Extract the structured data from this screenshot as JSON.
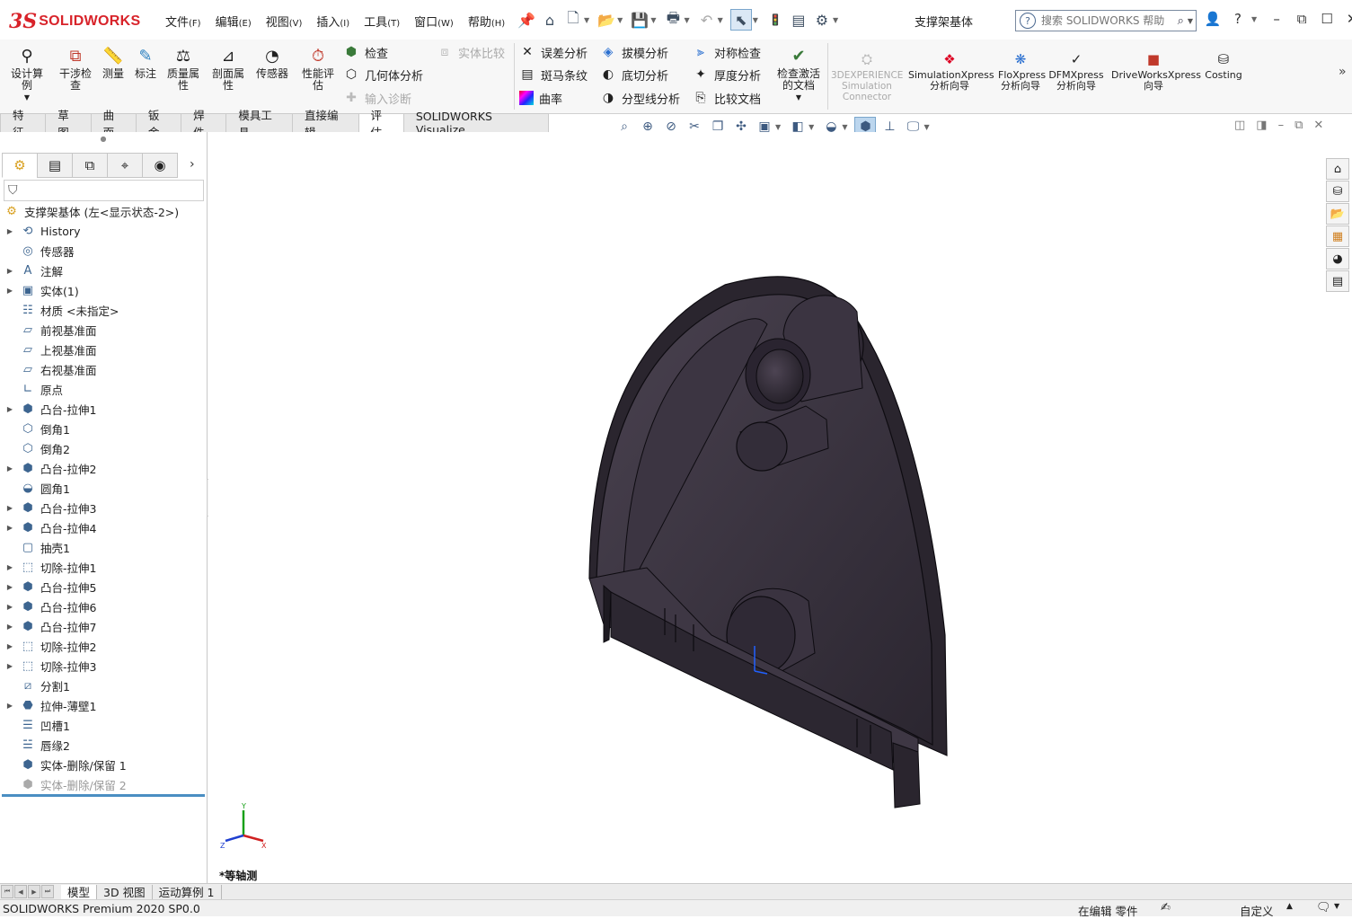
{
  "app": {
    "logo_prefix": "3S",
    "logo_name": "SOLIDWORKS",
    "document_title": "支撑架基体",
    "status_text": "SOLIDWORKS Premium 2020 SP0.0"
  },
  "menu": [
    {
      "label": "文件",
      "key": "(F)"
    },
    {
      "label": "编辑",
      "key": "(E)"
    },
    {
      "label": "视图",
      "key": "(V)"
    },
    {
      "label": "插入",
      "key": "(I)"
    },
    {
      "label": "工具",
      "key": "(T)"
    },
    {
      "label": "窗口",
      "key": "(W)"
    },
    {
      "label": "帮助",
      "key": "(H)"
    }
  ],
  "search": {
    "placeholder": "搜索 SOLIDWORKS 帮助"
  },
  "ribbon": {
    "design_study": "设计算例",
    "interference": "干涉检查",
    "measure": "测量",
    "markup": "标注",
    "mass_props": "质量属性",
    "section_props": "剖面属性",
    "sensor": "传感器",
    "performance": "性能评估",
    "check": "检查",
    "geometry_analysis": "几何体分析",
    "import_diag": "输入诊断",
    "body_compare": "实体比较",
    "deviation": "误差分析",
    "zebra": "斑马条纹",
    "curvature": "曲率",
    "draft": "拔模分析",
    "undercut": "底切分析",
    "parting_line": "分型线分析",
    "symmetry": "对称检查",
    "thickness": "厚度分析",
    "compare_docs": "比较文档",
    "check_active": "检查激活的文档",
    "dx_connector": "3DEXPERIENCE Simulation Connector",
    "simxpress": "SimulationXpress 分析向导",
    "floxpress": "FloXpress 分析向导",
    "dfmxpress": "DFMXpress 分析向导",
    "driveworks": "DriveWorksXpress 向导",
    "costing": "Costing"
  },
  "tabs": [
    "特征",
    "草图",
    "曲面",
    "钣金",
    "焊件",
    "模具工具",
    "直接编辑",
    "评估",
    "SOLIDWORKS Visualize"
  ],
  "active_tab": "评估",
  "tree": {
    "root": "支撑架基体  (左<显示状态-2>)",
    "items": [
      {
        "label": "History",
        "expandable": true,
        "icon": "history-icon"
      },
      {
        "label": "传感器",
        "expandable": false,
        "icon": "sensor-icon"
      },
      {
        "label": "注解",
        "expandable": true,
        "icon": "annotation-icon"
      },
      {
        "label": "实体(1)",
        "expandable": true,
        "icon": "solid-bodies-icon"
      },
      {
        "label": "材质 <未指定>",
        "expandable": false,
        "icon": "material-icon"
      },
      {
        "label": "前视基准面",
        "expandable": false,
        "icon": "plane-icon"
      },
      {
        "label": "上视基准面",
        "expandable": false,
        "icon": "plane-icon"
      },
      {
        "label": "右视基准面",
        "expandable": false,
        "icon": "plane-icon"
      },
      {
        "label": "原点",
        "expandable": false,
        "icon": "origin-icon"
      },
      {
        "label": "凸台-拉伸1",
        "expandable": true,
        "icon": "boss-extrude-icon"
      },
      {
        "label": "倒角1",
        "expandable": false,
        "icon": "chamfer-icon"
      },
      {
        "label": "倒角2",
        "expandable": false,
        "icon": "chamfer-icon"
      },
      {
        "label": "凸台-拉伸2",
        "expandable": true,
        "icon": "boss-extrude-icon"
      },
      {
        "label": "圆角1",
        "expandable": false,
        "icon": "fillet-icon"
      },
      {
        "label": "凸台-拉伸3",
        "expandable": true,
        "icon": "boss-extrude-icon"
      },
      {
        "label": "凸台-拉伸4",
        "expandable": true,
        "icon": "boss-extrude-icon"
      },
      {
        "label": "抽壳1",
        "expandable": false,
        "icon": "shell-icon"
      },
      {
        "label": "切除-拉伸1",
        "expandable": true,
        "icon": "cut-extrude-icon"
      },
      {
        "label": "凸台-拉伸5",
        "expandable": true,
        "icon": "boss-extrude-icon"
      },
      {
        "label": "凸台-拉伸6",
        "expandable": true,
        "icon": "boss-extrude-icon"
      },
      {
        "label": "凸台-拉伸7",
        "expandable": true,
        "icon": "boss-extrude-icon"
      },
      {
        "label": "切除-拉伸2",
        "expandable": true,
        "icon": "cut-extrude-icon"
      },
      {
        "label": "切除-拉伸3",
        "expandable": true,
        "icon": "cut-extrude-icon"
      },
      {
        "label": "分割1",
        "expandable": false,
        "icon": "split-icon"
      },
      {
        "label": "拉伸-薄壁1",
        "expandable": true,
        "icon": "thin-extrude-icon"
      },
      {
        "label": "凹槽1",
        "expandable": false,
        "icon": "groove-icon"
      },
      {
        "label": "唇缘2",
        "expandable": false,
        "icon": "lip-icon"
      },
      {
        "label": "实体-删除/保留 1",
        "expandable": false,
        "icon": "delete-body-icon"
      },
      {
        "label": "实体-删除/保留 2",
        "expandable": false,
        "icon": "delete-body-icon",
        "suppressed": true
      }
    ]
  },
  "viewport": {
    "view_label": "*等轴测",
    "triad": {
      "x": "X",
      "y": "Y",
      "z": "Z"
    }
  },
  "bottom_tabs": [
    "模型",
    "3D 视图",
    "运动算例 1"
  ],
  "active_bottom_tab": "模型",
  "status": {
    "editing": "在编辑 零件",
    "units": "自定义"
  },
  "colors": {
    "brand": "#d8232a",
    "part_face": "#3a3340",
    "part_edge": "#0d0b10",
    "selection_blue": "#4a8ec2"
  }
}
